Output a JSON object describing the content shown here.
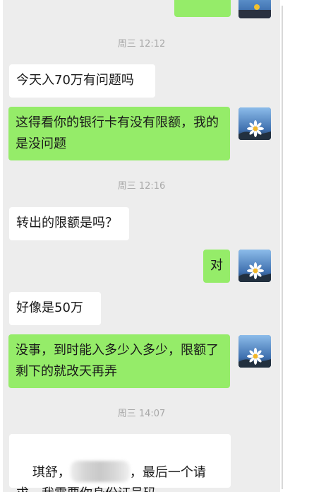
{
  "messages": [
    {
      "type": "outgoing-partial",
      "text": ""
    },
    {
      "type": "timestamp",
      "text": "周三 12:12"
    },
    {
      "type": "incoming",
      "text": "今天入70万有问题吗"
    },
    {
      "type": "outgoing",
      "text": "这得看你的银行卡有没有限额，我的是没问题"
    },
    {
      "type": "timestamp",
      "text": "周三 12:16"
    },
    {
      "type": "incoming",
      "text": "转出的限额是吗？"
    },
    {
      "type": "outgoing",
      "text": "对"
    },
    {
      "type": "incoming",
      "text": "好像是50万"
    },
    {
      "type": "outgoing",
      "text": "没事，到时能入多少入多少，限额了剩下的就改天再弄"
    },
    {
      "type": "timestamp",
      "text": "周三 14:07"
    },
    {
      "type": "incoming",
      "text_prefix": "琪舒，",
      "redacted": true,
      "text_suffix": "，最后一个请求，我需要你身份证号码"
    }
  ],
  "avatar_icon": "daisy-avatar-icon",
  "colors": {
    "background": "#ededed",
    "incoming_bubble": "#ffffff",
    "outgoing_bubble": "#95ec69",
    "timestamp": "#a8a8a8"
  }
}
